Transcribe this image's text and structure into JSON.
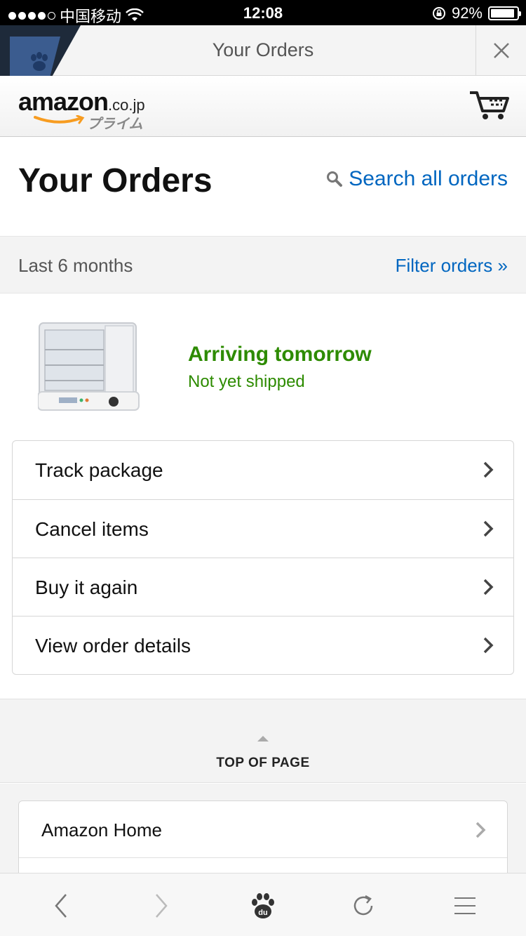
{
  "status_bar": {
    "carrier": "中国移动",
    "time": "12:08",
    "battery": "92%",
    "battery_level": 0.92
  },
  "browser": {
    "title": "Your Orders"
  },
  "header": {
    "logo_word": "amazon",
    "logo_tld": ".co.jp",
    "logo_sub": "プライム"
  },
  "page": {
    "title": "Your Orders",
    "search_label": "Search all orders",
    "period": "Last 6 months",
    "filter_label": "Filter orders »"
  },
  "order": {
    "status": "Arriving tomorrow",
    "substatus": "Not yet shipped",
    "actions": [
      {
        "label": "Track package"
      },
      {
        "label": "Cancel items"
      },
      {
        "label": "Buy it again"
      },
      {
        "label": "View order details"
      }
    ]
  },
  "footer": {
    "top_of_page": "TOP OF PAGE",
    "links": [
      {
        "label": "Amazon Home"
      }
    ]
  },
  "icons": {
    "close": "close-icon",
    "cart": "cart-icon",
    "search": "search-icon",
    "chevron": "chevron-right-icon",
    "back": "back-arrow-icon",
    "forward": "forward-arrow-icon",
    "home": "baidu-paw-icon",
    "refresh": "refresh-icon",
    "menu": "menu-icon"
  },
  "colors": {
    "link": "#0066c0",
    "success": "#2d8b00",
    "smile": "#f79c20"
  }
}
